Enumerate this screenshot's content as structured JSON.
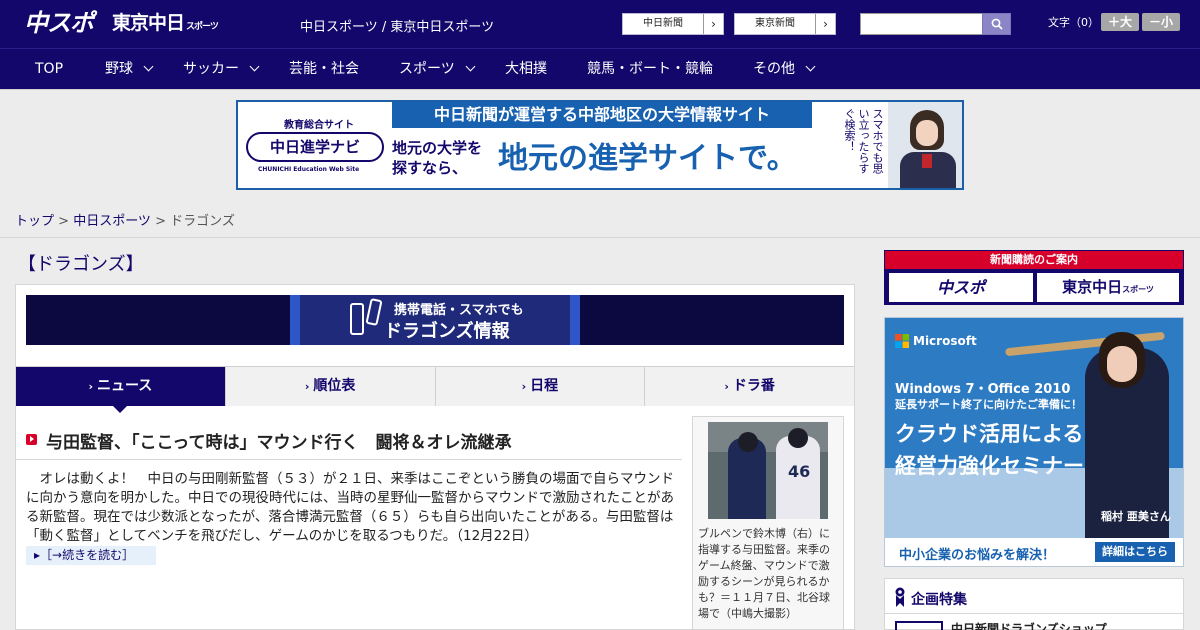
{
  "header": {
    "logo_primary": "中スポ",
    "logo_secondary": "東京中日",
    "logo_secondary_small": "スポーツ",
    "site_links": "中日スポーツ / 東京中日スポーツ",
    "paper_buttons": [
      {
        "label": "中日新聞",
        "arrow": "›"
      },
      {
        "label": "東京新聞",
        "arrow": "›"
      }
    ],
    "search_placeholder": "",
    "font_size_label": "文字（0）",
    "font_bigger": "＋大",
    "font_smaller": "－小"
  },
  "nav": {
    "items": [
      {
        "label": "TOP",
        "has_dropdown": false
      },
      {
        "label": "野球",
        "has_dropdown": true
      },
      {
        "label": "サッカー",
        "has_dropdown": true
      },
      {
        "label": "芸能・社会",
        "has_dropdown": false
      },
      {
        "label": "スポーツ",
        "has_dropdown": true
      },
      {
        "label": "大相撲",
        "has_dropdown": false
      },
      {
        "label": "競馬・ボート・競輪",
        "has_dropdown": false
      },
      {
        "label": "その他",
        "has_dropdown": true
      }
    ]
  },
  "top_banner": {
    "subtitle": "教育総合サイト",
    "logo": "中日進学ナビ",
    "logo_en": "CHUNICHI Education Web Site",
    "strip": "中日新聞が運営する中部地区の大学情報サイト",
    "catch_small": "地元の大学を探すなら、",
    "catch_big": "地元の進学サイトで。",
    "vertical": "スマホでも思い立ったらすぐ検索！"
  },
  "breadcrumb": {
    "items": [
      "トップ",
      "中日スポーツ",
      "ドラゴンズ"
    ],
    "separator": " > "
  },
  "main": {
    "category_title": "【ドラゴンズ】",
    "dragons_banner": {
      "line1": "携帯電話・スマホでも",
      "line2": "ドラゴンズ情報"
    },
    "tabs": [
      {
        "label": "ニュース",
        "active": true
      },
      {
        "label": "順位表",
        "active": false
      },
      {
        "label": "日程",
        "active": false
      },
      {
        "label": "ドラ番",
        "active": false
      }
    ],
    "article": {
      "headline": "与田監督、「ここって時は」マウンド行く　闘将＆オレ流継承",
      "body": "　オレは動くよ！　中日の与田剛新監督（５３）が２１日、来季はここぞという勝負の場面で自らマウンドに向かう意向を明かした。中日での現役時代には、当時の星野仙一監督からマウンドで激励されたことがある新監督。現在では少数派となったが、落合博満元監督（６５）らも自ら出向いたことがある。与田監督は「動く監督」としてベンチを飛びだし、ゲームのかじを取るつもりだ。（12月22日）",
      "more": "［→続きを読む］",
      "photo_caption": "ブルペンで鈴木博（右）に指導する与田監督。来季のゲーム終盤、マウンドで激励するシーンが見られるかも？＝１１月７日、北谷球場で（中嶋大撮影）",
      "jersey_number": "46"
    }
  },
  "sidebar": {
    "subscribe": {
      "heading": "新聞購読のご案内",
      "btn1": "中スポ",
      "btn2": "東京中日",
      "btn2_small": "スポーツ"
    },
    "ad": {
      "brand": "Microsoft",
      "line1": "Windows 7・Office 2010",
      "line2": "延長サポート終了に向けたご準備に！",
      "line3": "クラウド活用による",
      "line4": "経営力強化セミナー",
      "person": "稲村 亜美さん",
      "footer": "中小企業のお悩みを解決！",
      "cta": "詳細はこちら"
    },
    "feature": {
      "title": "企画特集",
      "item1": "中日新聞ドラゴンズショップ"
    }
  },
  "colors": {
    "brand_navy": "#13076b",
    "accent_red": "#d6002b",
    "link_blue": "#1761b0"
  }
}
